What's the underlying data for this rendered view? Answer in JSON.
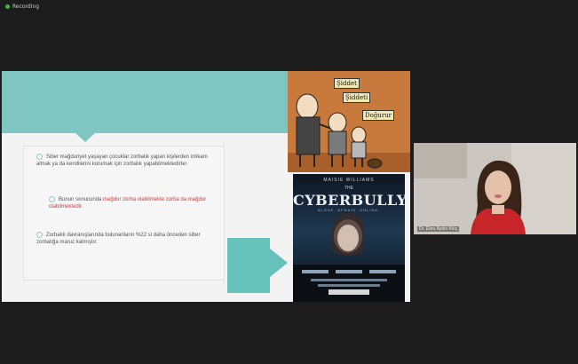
{
  "app": {
    "recording_label": "Recording"
  },
  "slide": {
    "bullets": [
      {
        "text": "Siber mağduriyet yaşayan çocuklar zorbalık yapan kişilerden intikam almak ya da kendilerini korumak için zorbalık yapabilmektedirler."
      },
      {
        "text_before": "Bunun sonucunda ",
        "highlight": "mağdur zorba olabilmekte zorba da mağdur olabilmektedir.",
        "text_after": ""
      },
      {
        "text": "Zorbalık davranışlarında bulunanların %22 si daha önceden siber zorbalığa maruz kalmıştır."
      }
    ],
    "teal_box_text": "",
    "cartoon_signs": [
      "Şiddet",
      "Şiddeti",
      "Doğurur"
    ],
    "poster": {
      "actor": "MAISIE WILLIAMS",
      "title_small": "THE",
      "title": "CYBERBULLY",
      "tagline": "ALONE. AFRAID. ONLINE."
    }
  },
  "participant": {
    "name": "Dr. Ebru Aydın Kılıç"
  },
  "colors": {
    "teal": "#7fc6c3",
    "teal_dark": "#67c1bb",
    "highlight_red": "#d23a3a"
  }
}
